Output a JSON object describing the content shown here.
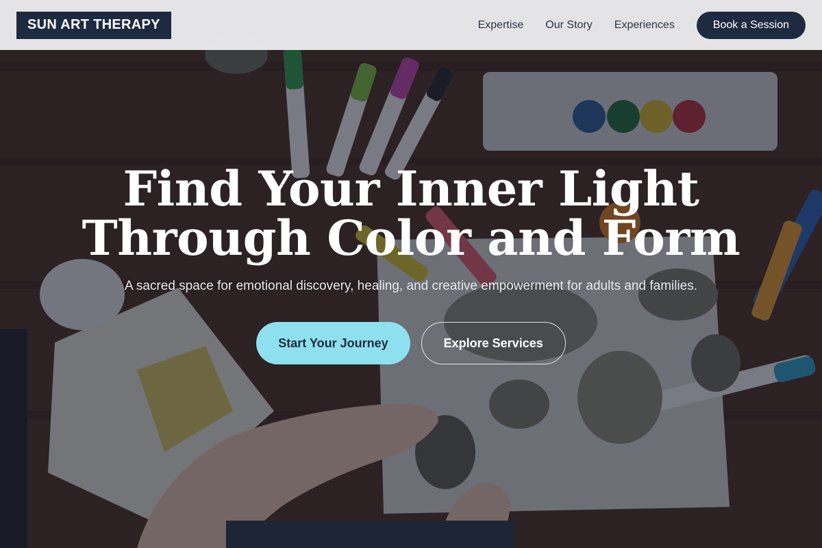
{
  "header": {
    "logo": "SUN ART THERAPY",
    "nav": [
      {
        "label": "Expertise"
      },
      {
        "label": "Our Story"
      },
      {
        "label": "Experiences"
      }
    ],
    "cta": "Book a Session"
  },
  "hero": {
    "title_line1": "Find Your Inner Light",
    "title_line2": "Through Color and Form",
    "subtitle": "A sacred space for emotional discovery, healing, and creative empowerment for adults and families.",
    "primary_button": "Start Your Journey",
    "secondary_button": "Explore Services",
    "background_image": "Child painting stones on paper with markers and a watercolor palette on a wooden table"
  },
  "colors": {
    "navy": "#1e2a40",
    "accent_cyan": "#8fe0ef",
    "header_bg": "#ececee",
    "text_light": "#ffffff"
  }
}
